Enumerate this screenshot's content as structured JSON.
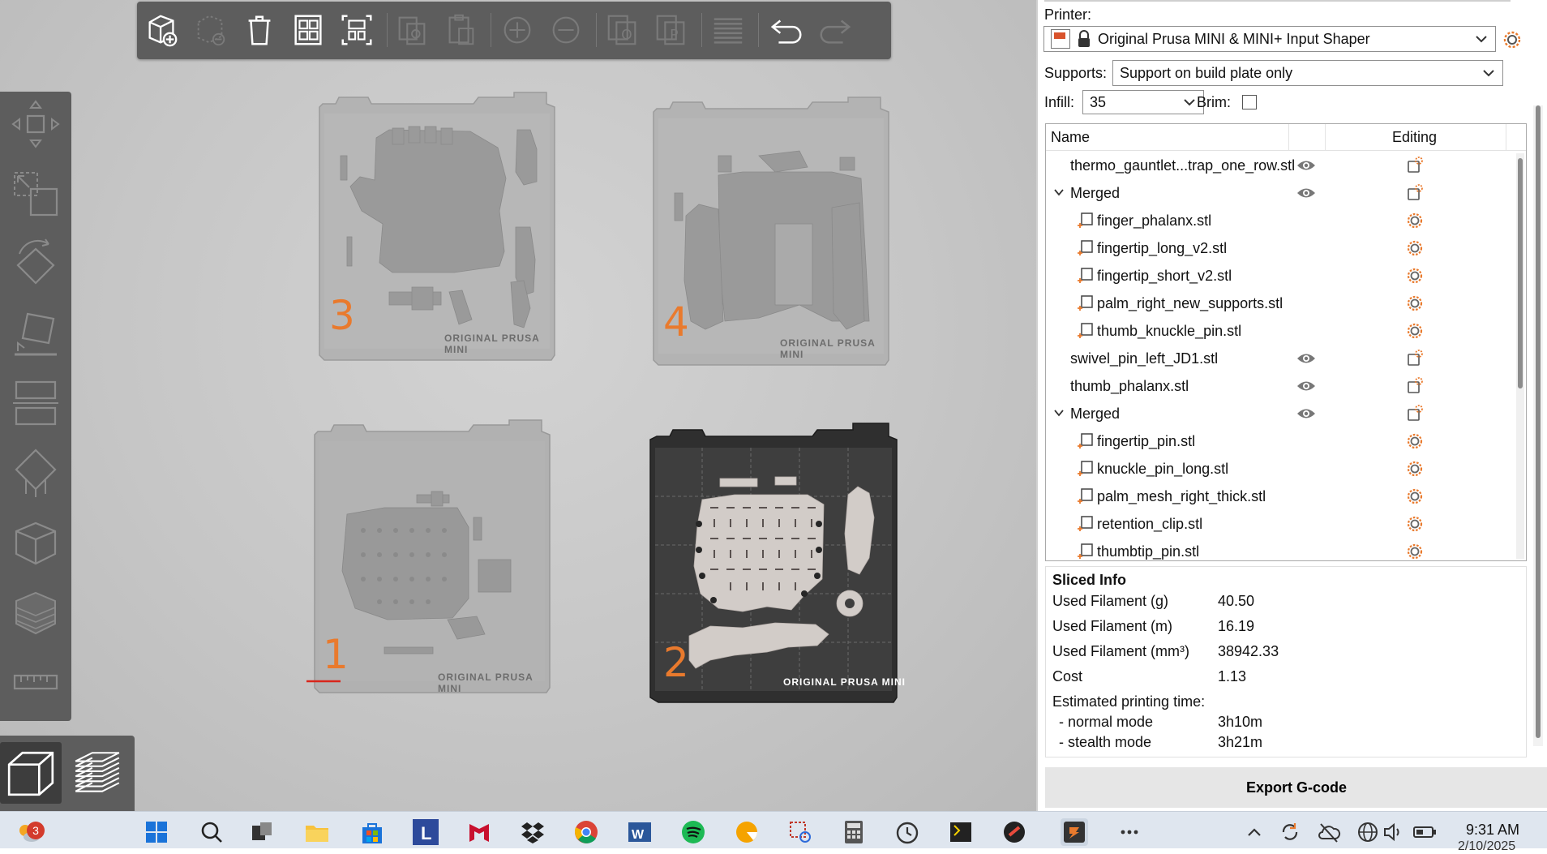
{
  "viewport": {
    "beds": [
      {
        "number": "3",
        "label": "ORIGINAL PRUSA MINI"
      },
      {
        "number": "4",
        "label": "ORIGINAL PRUSA MINI"
      },
      {
        "number": "1",
        "label": "ORIGINAL PRUSA MINI"
      },
      {
        "number": "2",
        "label": "ORIGINAL PRUSA MINI"
      }
    ]
  },
  "top_toolbar": {
    "icons": [
      "add-icon",
      "delete-icon",
      "delete-all-icon",
      "arrange-icon",
      "arrange-selection-icon",
      "copy-icon",
      "paste-icon",
      "add-instance-icon",
      "remove-instance-icon",
      "split-objects-icon",
      "split-parts-icon",
      "layers-editing-icon",
      "undo-icon",
      "redo-icon"
    ]
  },
  "left_toolbar": {
    "icons": [
      "move-icon",
      "scale-icon",
      "rotate-icon",
      "place-on-face-icon",
      "cut-icon",
      "support-painting-icon",
      "seam-painting-icon",
      "variable-layer-icon",
      "measure-icon"
    ]
  },
  "panel": {
    "printer_label": "Printer:",
    "printer_value": "Original Prusa MINI & MINI+ Input Shaper",
    "supports_label": "Supports:",
    "supports_value": "Support on build plate only",
    "infill_label": "Infill:",
    "infill_value": "35",
    "brim_label": "Brim:",
    "list_header_name": "Name",
    "list_header_editing": "Editing",
    "objects": [
      {
        "name": "thermo_gauntlet...trap_one_row.stl",
        "level": 0
      },
      {
        "name": "Merged",
        "level": 0,
        "expandable": true
      },
      {
        "name": "finger_phalanx.stl",
        "level": 1
      },
      {
        "name": "fingertip_long_v2.stl",
        "level": 1
      },
      {
        "name": "fingertip_short_v2.stl",
        "level": 1
      },
      {
        "name": "palm_right_new_supports.stl",
        "level": 1
      },
      {
        "name": "thumb_knuckle_pin.stl",
        "level": 1
      },
      {
        "name": "swivel_pin_left_JD1.stl",
        "level": 0
      },
      {
        "name": "thumb_phalanx.stl",
        "level": 0
      },
      {
        "name": "Merged",
        "level": 0,
        "expandable": true
      },
      {
        "name": "fingertip_pin.stl",
        "level": 1
      },
      {
        "name": "knuckle_pin_long.stl",
        "level": 1
      },
      {
        "name": "palm_mesh_right_thick.stl",
        "level": 1
      },
      {
        "name": "retention_clip.stl",
        "level": 1
      },
      {
        "name": "thumbtip_pin.stl",
        "level": 1
      }
    ],
    "sliced_info": {
      "title": "Sliced Info",
      "used_filament_g_label": "Used Filament (g)",
      "used_filament_g": "40.50",
      "used_filament_m_label": "Used Filament (m)",
      "used_filament_m": "16.19",
      "used_filament_mm3_label": "Used Filament (mm³)",
      "used_filament_mm3": "38942.33",
      "cost_label": "Cost",
      "cost": "1.13",
      "est_time_label": "Estimated printing time:",
      "normal_mode_label": "- normal mode",
      "normal_mode": "3h10m",
      "stealth_mode_label": "- stealth mode",
      "stealth_mode": "3h21m"
    },
    "export_label": "Export G-code"
  },
  "taskbar": {
    "notification_count": "3",
    "time": "9:31 AM",
    "date": "2/10/2025"
  },
  "colors": {
    "accent_orange": "#e97a2d",
    "toolbar_bg": "#5d5d5d",
    "active_bed": "#2e2e2e"
  }
}
